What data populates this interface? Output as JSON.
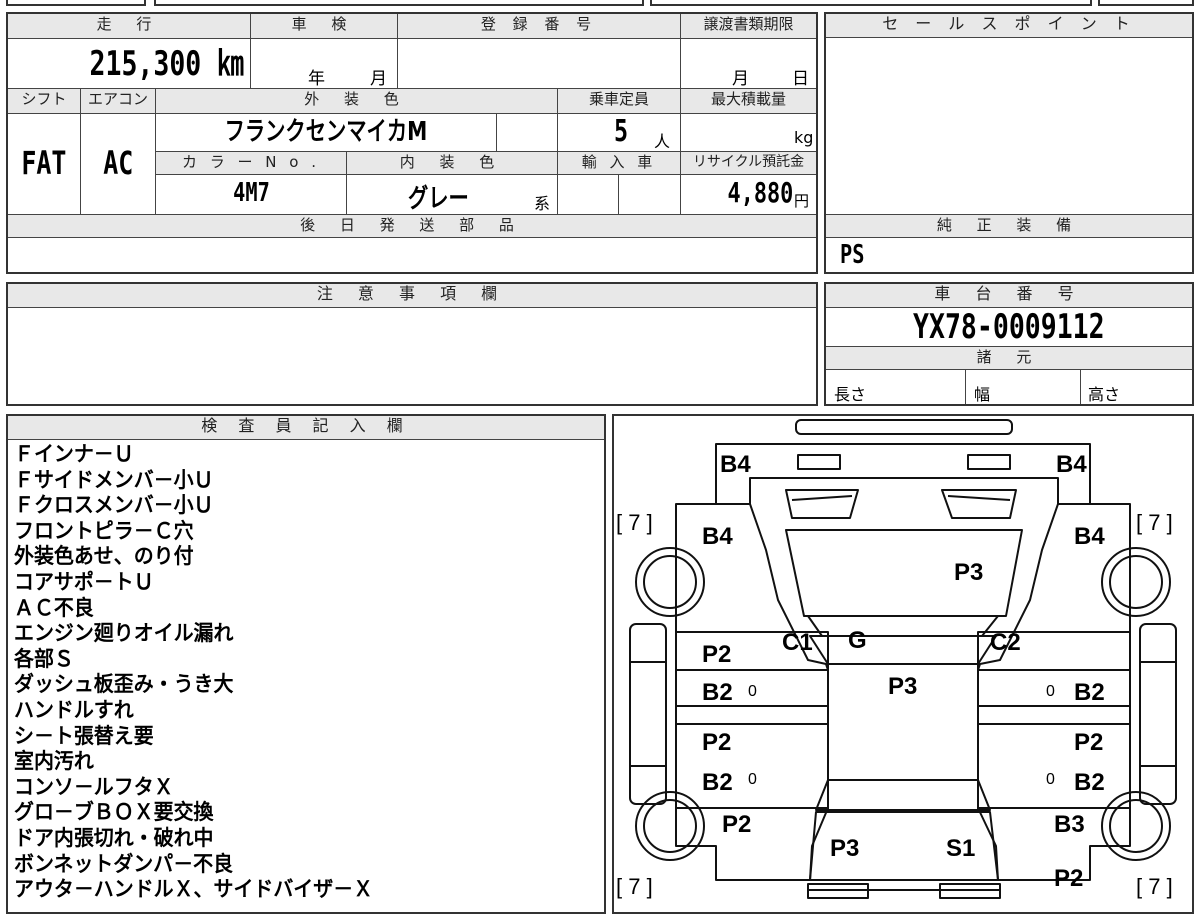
{
  "summary": {
    "mileage_header": "走 行",
    "mileage_value": "215,300 ㎞",
    "inspection_header": "車 検",
    "inspection_year": "年",
    "inspection_month": "月",
    "registration_header": "登 録 番 号",
    "transfer_header": "譲渡書類期限",
    "transfer_month": "月",
    "transfer_day": "日",
    "shift_header": "シフト",
    "shift_value": "FAT",
    "ac_header": "エアコン",
    "ac_value": "AC",
    "exterior_color_header": "外 装 色",
    "exterior_color_value": "フランクセンマイカM",
    "capacity_header": "乗車定員",
    "capacity_value": "5",
    "capacity_unit": "人",
    "max_load_header": "最大積載量",
    "max_load_unit": "kg",
    "color_no_header": "カ ラ ー N o .",
    "color_no_value": "4M7",
    "interior_color_header": "内 装 色",
    "interior_color_value": "グレー",
    "interior_color_suffix": "系",
    "import_header": "輸 入 車",
    "recycle_header": "リサイクル預託金",
    "recycle_value": "4,880",
    "recycle_unit": "円",
    "later_parts_header": "後 日 発 送 部 品"
  },
  "sales_point": {
    "header": "セ ー ル ス ポ イ ン ト"
  },
  "genuine_equipment": {
    "header": "純 正 装 備",
    "value": "PS"
  },
  "notes": {
    "header": "注 意 事 項 欄"
  },
  "chassis": {
    "header": "車 台 番 号",
    "value": "YX78-0009112",
    "specs_header": "諸 元",
    "length_label": "長さ",
    "width_label": "幅",
    "height_label": "高さ"
  },
  "inspector": {
    "header": "検 査 員 記 入 欄",
    "lines": [
      "Ｆインナ－Ｕ",
      "Ｆサイドメンバ－小Ｕ",
      "Ｆクロスメンバ－小Ｕ",
      "フロントピラ－Ｃ穴",
      "外装色あせ、のり付",
      "コアサポ－トＵ",
      "ＡＣ不良",
      "エンジン廻りオイル漏れ",
      "各部Ｓ",
      "ダッシュ板歪み・うき大",
      "ハンドルすれ",
      "シ－ト張替え要",
      "室内汚れ",
      "コンソ－ルフタＸ",
      "グロ－ブＢＯＸ要交換",
      "ドア内張切れ・破れ中",
      "ボンネットダンパ－不良",
      "アウタ－ハンドルＸ、サイドバイザ－Ｘ"
    ]
  },
  "diagram": {
    "marks": {
      "front_bumper_left": "B4",
      "front_bumper_right": "B4",
      "front_fender_left": "B4",
      "front_fender_right": "B4",
      "hood": "P3",
      "tire_front_left": "[ 7 ]",
      "tire_front_right": "[ 7 ]",
      "tire_rear_left": "[ 7 ]",
      "tire_rear_right": "[ 7 ]",
      "pillar_left": "C1",
      "windshield": "G",
      "pillar_right": "C2",
      "roof": "P3",
      "front_door_left_paint": "P2",
      "front_door_left_dent": "B2",
      "rear_door_left_paint": "P2",
      "rear_door_left_dent": "B2",
      "front_door_right_dent": "B2",
      "rear_door_right_paint": "P2",
      "rear_door_right_dent": "B2",
      "rear_fender_left": "P2",
      "rear_fender_right_dent": "B3",
      "rear_fender_right_paint": "P2",
      "trunk_left": "P3",
      "trunk_right": "S1",
      "door_marker": "0"
    }
  }
}
